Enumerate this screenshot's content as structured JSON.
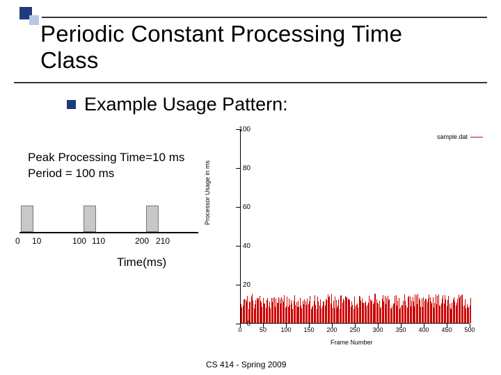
{
  "title": {
    "line1": "Periodic Constant Processing Time",
    "line2": "Class"
  },
  "bullet": "Example Usage Pattern:",
  "params": {
    "peak": "Peak Processing Time=10 ms",
    "period": "Period = 100 ms"
  },
  "timeline": {
    "labels": [
      "0",
      "10",
      "100",
      "110",
      "200",
      "210"
    ],
    "axis_label": "Time(ms)"
  },
  "footer": "CS 414 - Spring 2009",
  "chart_data": {
    "type": "bar",
    "title": "",
    "xlabel": "Frame Number",
    "ylabel": "Processor Usage in ms",
    "xlim": [
      0,
      500
    ],
    "ylim": [
      0,
      100
    ],
    "xticks": [
      0,
      50,
      100,
      150,
      200,
      250,
      300,
      350,
      400,
      450,
      500
    ],
    "yticks": [
      0,
      20,
      40,
      60,
      80,
      100
    ],
    "series": [
      {
        "name": "sample.dat",
        "color": "#c00",
        "typical_value": 10,
        "note": "dense per-frame spikes ~10ms across 0-500"
      }
    ]
  }
}
